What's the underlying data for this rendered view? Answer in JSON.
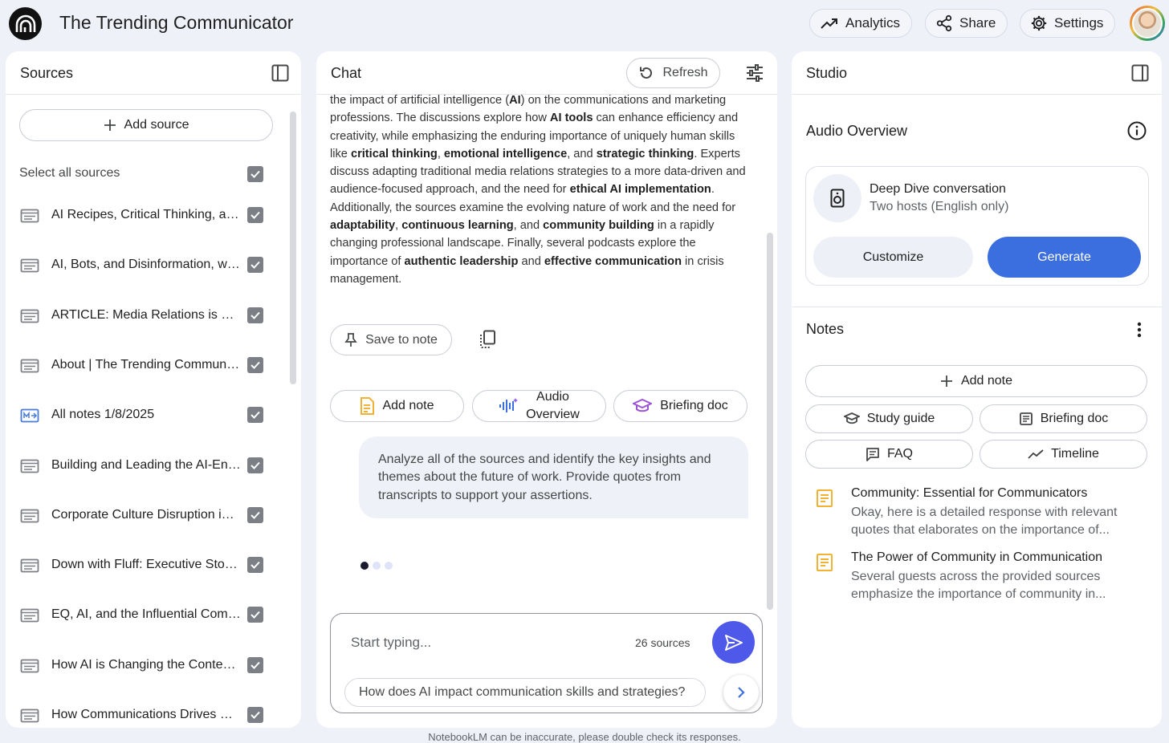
{
  "app": {
    "title": "The Trending Communicator"
  },
  "header": {
    "analytics_label": "Analytics",
    "share_label": "Share",
    "settings_label": "Settings"
  },
  "sources": {
    "title": "Sources",
    "add_label": "Add source",
    "select_all_label": "Select all sources",
    "items": [
      {
        "label": "AI Recipes, Critical Thinking, and the Future of Communications",
        "icon": "document-icon"
      },
      {
        "label": "AI, Bots, and Disinformation, with Kelsey Oliver",
        "icon": "document-icon"
      },
      {
        "label": "ARTICLE: Media Relations is Dead. Long Live Media Relations",
        "icon": "document-icon"
      },
      {
        "label": "About | The Trending Communicator",
        "icon": "document-icon"
      },
      {
        "label": "All notes 1/8/2025",
        "icon": "notes-icon"
      },
      {
        "label": "Building and Leading the AI-Enabled Team",
        "icon": "document-icon"
      },
      {
        "label": "Corporate Culture Disruption in the Age of AI",
        "icon": "document-icon"
      },
      {
        "label": "Down with Fluff: Executive Storytelling",
        "icon": "document-icon"
      },
      {
        "label": "EQ, AI, and the Influential Communicator",
        "icon": "document-icon"
      },
      {
        "label": "How AI is Changing the Content Game",
        "icon": "document-icon"
      },
      {
        "label": "How Communications Drives Growth",
        "icon": "document-icon"
      }
    ]
  },
  "chat": {
    "title": "Chat",
    "refresh_label": "Refresh",
    "summary": [
      {
        "t": "the impact of artificial intelligence ("
      },
      {
        "t": "AI",
        "b": true
      },
      {
        "t": ") on the communications and marketing professions. The discussions explore how "
      },
      {
        "t": "AI tools",
        "b": true
      },
      {
        "t": " can enhance efficiency and creativity, while emphasizing the enduring importance of uniquely human skills like "
      },
      {
        "t": "critical thinking",
        "b": true
      },
      {
        "t": ", "
      },
      {
        "t": "emotional intelligence",
        "b": true
      },
      {
        "t": ", and "
      },
      {
        "t": "strategic thinking",
        "b": true
      },
      {
        "t": ". Experts discuss adapting traditional media relations strategies to a more data-driven and audience-focused approach, and the need for "
      },
      {
        "t": "ethical AI implementation",
        "b": true
      },
      {
        "t": ". Additionally, the sources examine the evolving nature of work and the need for "
      },
      {
        "t": "adaptability",
        "b": true
      },
      {
        "t": ", "
      },
      {
        "t": "continuous learning",
        "b": true
      },
      {
        "t": ", and "
      },
      {
        "t": "community building",
        "b": true
      },
      {
        "t": " in a rapidly changing professional landscape. Finally, several podcasts explore the importance of "
      },
      {
        "t": "authentic leadership",
        "b": true
      },
      {
        "t": " and "
      },
      {
        "t": "effective communication",
        "b": true
      },
      {
        "t": " in crisis management."
      }
    ],
    "save_note_label": "Save to note",
    "chips": {
      "add_note": "Add note",
      "audio_overview_1": "Audio",
      "audio_overview_2": "Overview",
      "briefing_doc": "Briefing doc"
    },
    "user_message": "Analyze all of the sources and identify the key insights and themes about the future of work. Provide quotes from transcripts to support your assertions.",
    "input_placeholder": "Start typing...",
    "source_count": "26 sources",
    "suggestion": "How does AI impact communication skills and strategies?"
  },
  "studio": {
    "title": "Studio",
    "audio_overview_title": "Audio Overview",
    "deep_dive_title": "Deep Dive conversation",
    "deep_dive_sub": "Two hosts (English only)",
    "customize_label": "Customize",
    "generate_label": "Generate",
    "notes_title": "Notes",
    "add_note_label": "Add note",
    "study_guide_label": "Study guide",
    "briefing_doc_label": "Briefing doc",
    "faq_label": "FAQ",
    "timeline_label": "Timeline",
    "notes": [
      {
        "title": "Community: Essential for Communicators",
        "body": "Okay, here is a detailed response with relevant quotes that elaborates on the importance of..."
      },
      {
        "title": "The Power of Community in Communication",
        "body": "Several guests across the provided sources emphasize the importance of community in..."
      }
    ]
  },
  "footer": {
    "disclaimer": "NotebookLM can be inaccurate, please double check its responses."
  },
  "colors": {
    "accent": "#4e59ea",
    "generate": "#3b6fe0",
    "note_icon": "#f2b233",
    "background": "#eff1f9"
  }
}
